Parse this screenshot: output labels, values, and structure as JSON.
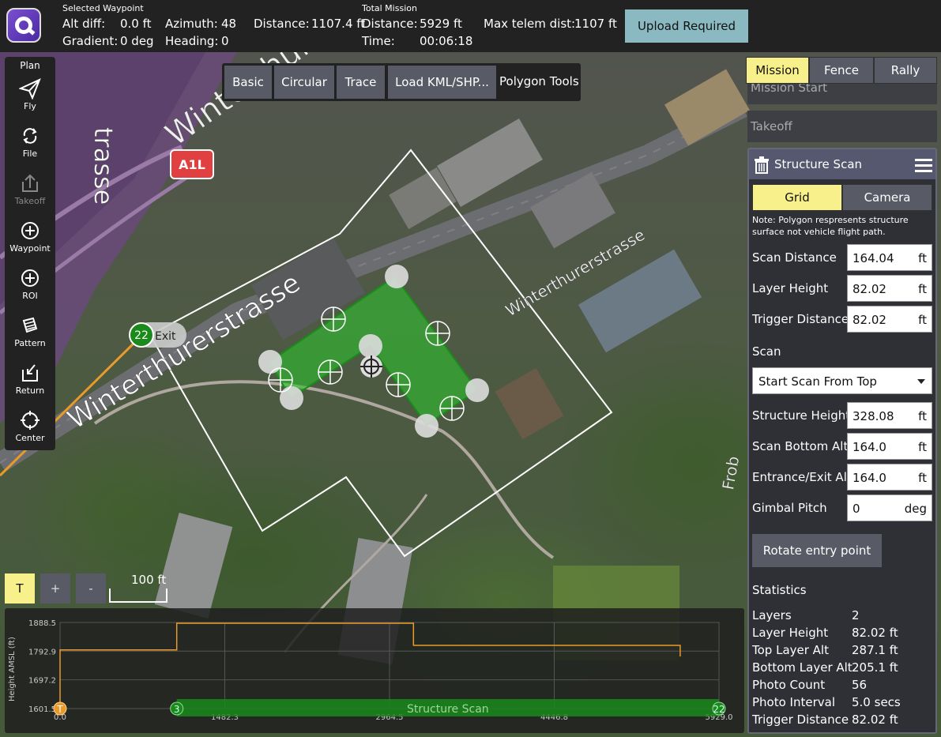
{
  "topbar": {
    "selected_waypoint_title": "Selected Waypoint",
    "alt_diff_label": "Alt diff:",
    "alt_diff_value": "0.0 ft",
    "gradient_label": "Gradient:",
    "gradient_value": "0 deg",
    "azimuth_label": "Azimuth:",
    "azimuth_value": "48",
    "heading_label": "Heading:",
    "heading_value": "0",
    "distance_label": "Distance:",
    "distance_value": "1107.4 ft",
    "total_mission_title": "Total Mission",
    "total_distance_label": "Distance:",
    "total_distance_value": "5929 ft",
    "time_label": "Time:",
    "time_value": "00:06:18",
    "max_telem_label": "Max telem dist:",
    "max_telem_value": "1107 ft",
    "upload_button": "Upload Required"
  },
  "left_toolbar": {
    "title": "Plan",
    "items": [
      {
        "label": "Fly",
        "icon": "paper-plane-icon"
      },
      {
        "label": "File",
        "icon": "sync-icon"
      },
      {
        "label": "Takeoff",
        "icon": "takeoff-icon"
      },
      {
        "label": "Waypoint",
        "icon": "plus-circle-icon"
      },
      {
        "label": "ROI",
        "icon": "plus-circle-icon"
      },
      {
        "label": "Pattern",
        "icon": "pattern-icon"
      },
      {
        "label": "Return",
        "icon": "return-icon"
      },
      {
        "label": "Center",
        "icon": "crosshair-icon"
      }
    ]
  },
  "polygon_tools": {
    "buttons": [
      "Basic",
      "Circular",
      "Trace",
      "Load KML/SHP..."
    ],
    "title": "Polygon Tools"
  },
  "map": {
    "street_labels": [
      "Winterthurerstrasse",
      "Winterthurerstrasse",
      "Winterthurerstrasse",
      "Frob"
    ],
    "fragment_label": "trasse",
    "road_sign": "A1L",
    "exit_marker": {
      "number": "22",
      "label": "Exit"
    },
    "scale_label": "100 ft",
    "zoom_buttons": {
      "toggle": "T",
      "zoom_in": "+",
      "zoom_out": "-"
    }
  },
  "right_panel": {
    "tabs": [
      {
        "label": "Mission",
        "active": true
      },
      {
        "label": "Fence",
        "active": false
      },
      {
        "label": "Rally",
        "active": false
      }
    ],
    "mission_start": "Mission Start",
    "takeoff": "Takeoff",
    "structure_scan": {
      "title": "Structure Scan",
      "subtabs": [
        {
          "label": "Grid",
          "active": true
        },
        {
          "label": "Camera",
          "active": false
        }
      ],
      "note": "Note: Polygon respresents structure surface not vehicle flight path.",
      "scan_distance": {
        "label": "Scan Distance",
        "value": "164.04",
        "unit": "ft"
      },
      "layer_height": {
        "label": "Layer Height",
        "value": "82.02",
        "unit": "ft"
      },
      "trigger_distance": {
        "label": "Trigger Distance",
        "value": "82.02",
        "unit": "ft"
      },
      "scan_section": "Scan",
      "scan_start": "Start Scan From Top",
      "structure_height": {
        "label": "Structure Height",
        "value": "328.08",
        "unit": "ft"
      },
      "scan_bottom_alt": {
        "label": "Scan Bottom Alt",
        "value": "164.0",
        "unit": "ft"
      },
      "entrance_exit_alt": {
        "label": "Entrance/Exit Alt",
        "value": "164.0",
        "unit": "ft"
      },
      "gimbal_pitch": {
        "label": "Gimbal Pitch",
        "value": "0",
        "unit": "deg"
      },
      "rotate_button": "Rotate entry point",
      "statistics_title": "Statistics",
      "stats": [
        {
          "label": "Layers",
          "value": "2"
        },
        {
          "label": "Layer Height",
          "value": "82.02 ft"
        },
        {
          "label": "Top Layer Alt",
          "value": "287.1 ft"
        },
        {
          "label": "Bottom Layer Alt",
          "value": "205.1 ft"
        },
        {
          "label": "Photo Count",
          "value": "56"
        },
        {
          "label": "Photo Interval",
          "value": "5.0 secs"
        },
        {
          "label": "Trigger Distance",
          "value": "82.02 ft"
        }
      ]
    }
  },
  "colors": {
    "accent_active": "#f8f08a",
    "button_bg": "#585a66",
    "upload_bg": "#8ab9c2",
    "scan_fill": "#2ec02e",
    "path_orange": "#e89a2a"
  },
  "chart_data": {
    "type": "line",
    "ylabel": "Height AMSL (ft)",
    "x_ticks": [
      "0.0",
      "1482.3",
      "2964.5",
      "4446.8",
      "5929.0"
    ],
    "y_ticks": [
      "1888.5",
      "1792.9",
      "1697.2",
      "1601.5"
    ],
    "xlim": [
      0,
      5929
    ],
    "ylim": [
      1601.5,
      1888.5
    ],
    "series": [
      {
        "x": [
          0,
          0,
          1050,
          1050,
          3180,
          3180,
          5580,
          5580
        ],
        "y": [
          1601.5,
          1797,
          1797,
          1886,
          1886,
          1812,
          1812,
          1775
        ]
      }
    ],
    "markers": [
      {
        "label": "T",
        "x": 0
      },
      {
        "label": "3",
        "x": 1050
      },
      {
        "label": "22",
        "x": 5929
      }
    ],
    "complex_item": {
      "label": "Structure Scan",
      "x_start": 1050,
      "x_end": 5929
    }
  }
}
